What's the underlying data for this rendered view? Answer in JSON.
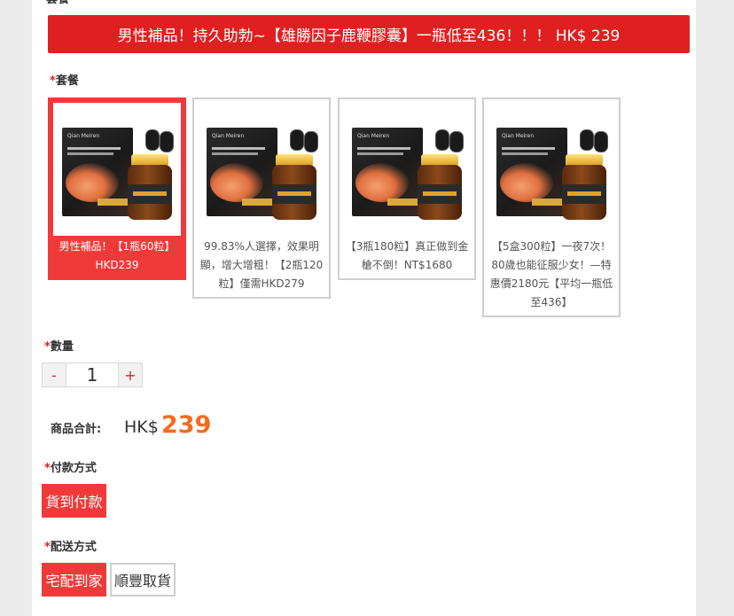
{
  "top_label": "套餐",
  "banner": "男性補品！持久助勃~【雄勝因子鹿鞭膠囊】一瓶低至436！！！ HK$ 239",
  "required_mark": "*",
  "package_section": {
    "label": "套餐",
    "packages": [
      {
        "brand": "Qian Meiren",
        "caption": "男性補品！【1瓶60粒】HKD239",
        "selected": true
      },
      {
        "brand": "Qian Meiren",
        "caption": "99.83%人選擇，效果明顯，增大增粗！【2瓶120粒】僅需HKD279",
        "selected": false
      },
      {
        "brand": "Qian Meiren",
        "caption": "【3瓶180粒】真正做到金槍不倒！NT$1680",
        "selected": false
      },
      {
        "brand": "Qian Meiren",
        "caption": "【5盒300粒】一夜7次！80歲也能征服少女！—特惠價2180元【平均一瓶低至436】",
        "selected": false
      }
    ]
  },
  "quantity": {
    "label": "數量",
    "minus": "-",
    "value": "1",
    "plus": "+"
  },
  "total": {
    "label": "商品合計:",
    "currency": "HK$",
    "amount": "239"
  },
  "payment": {
    "label": "付款方式",
    "options": [
      "貨到付款"
    ]
  },
  "delivery": {
    "label": "配送方式",
    "options": [
      "宅配到家",
      "順豐取貨"
    ]
  },
  "colors": {
    "accent": "#f03a3a",
    "banner": "#e02020",
    "price": "#f36c1e"
  }
}
